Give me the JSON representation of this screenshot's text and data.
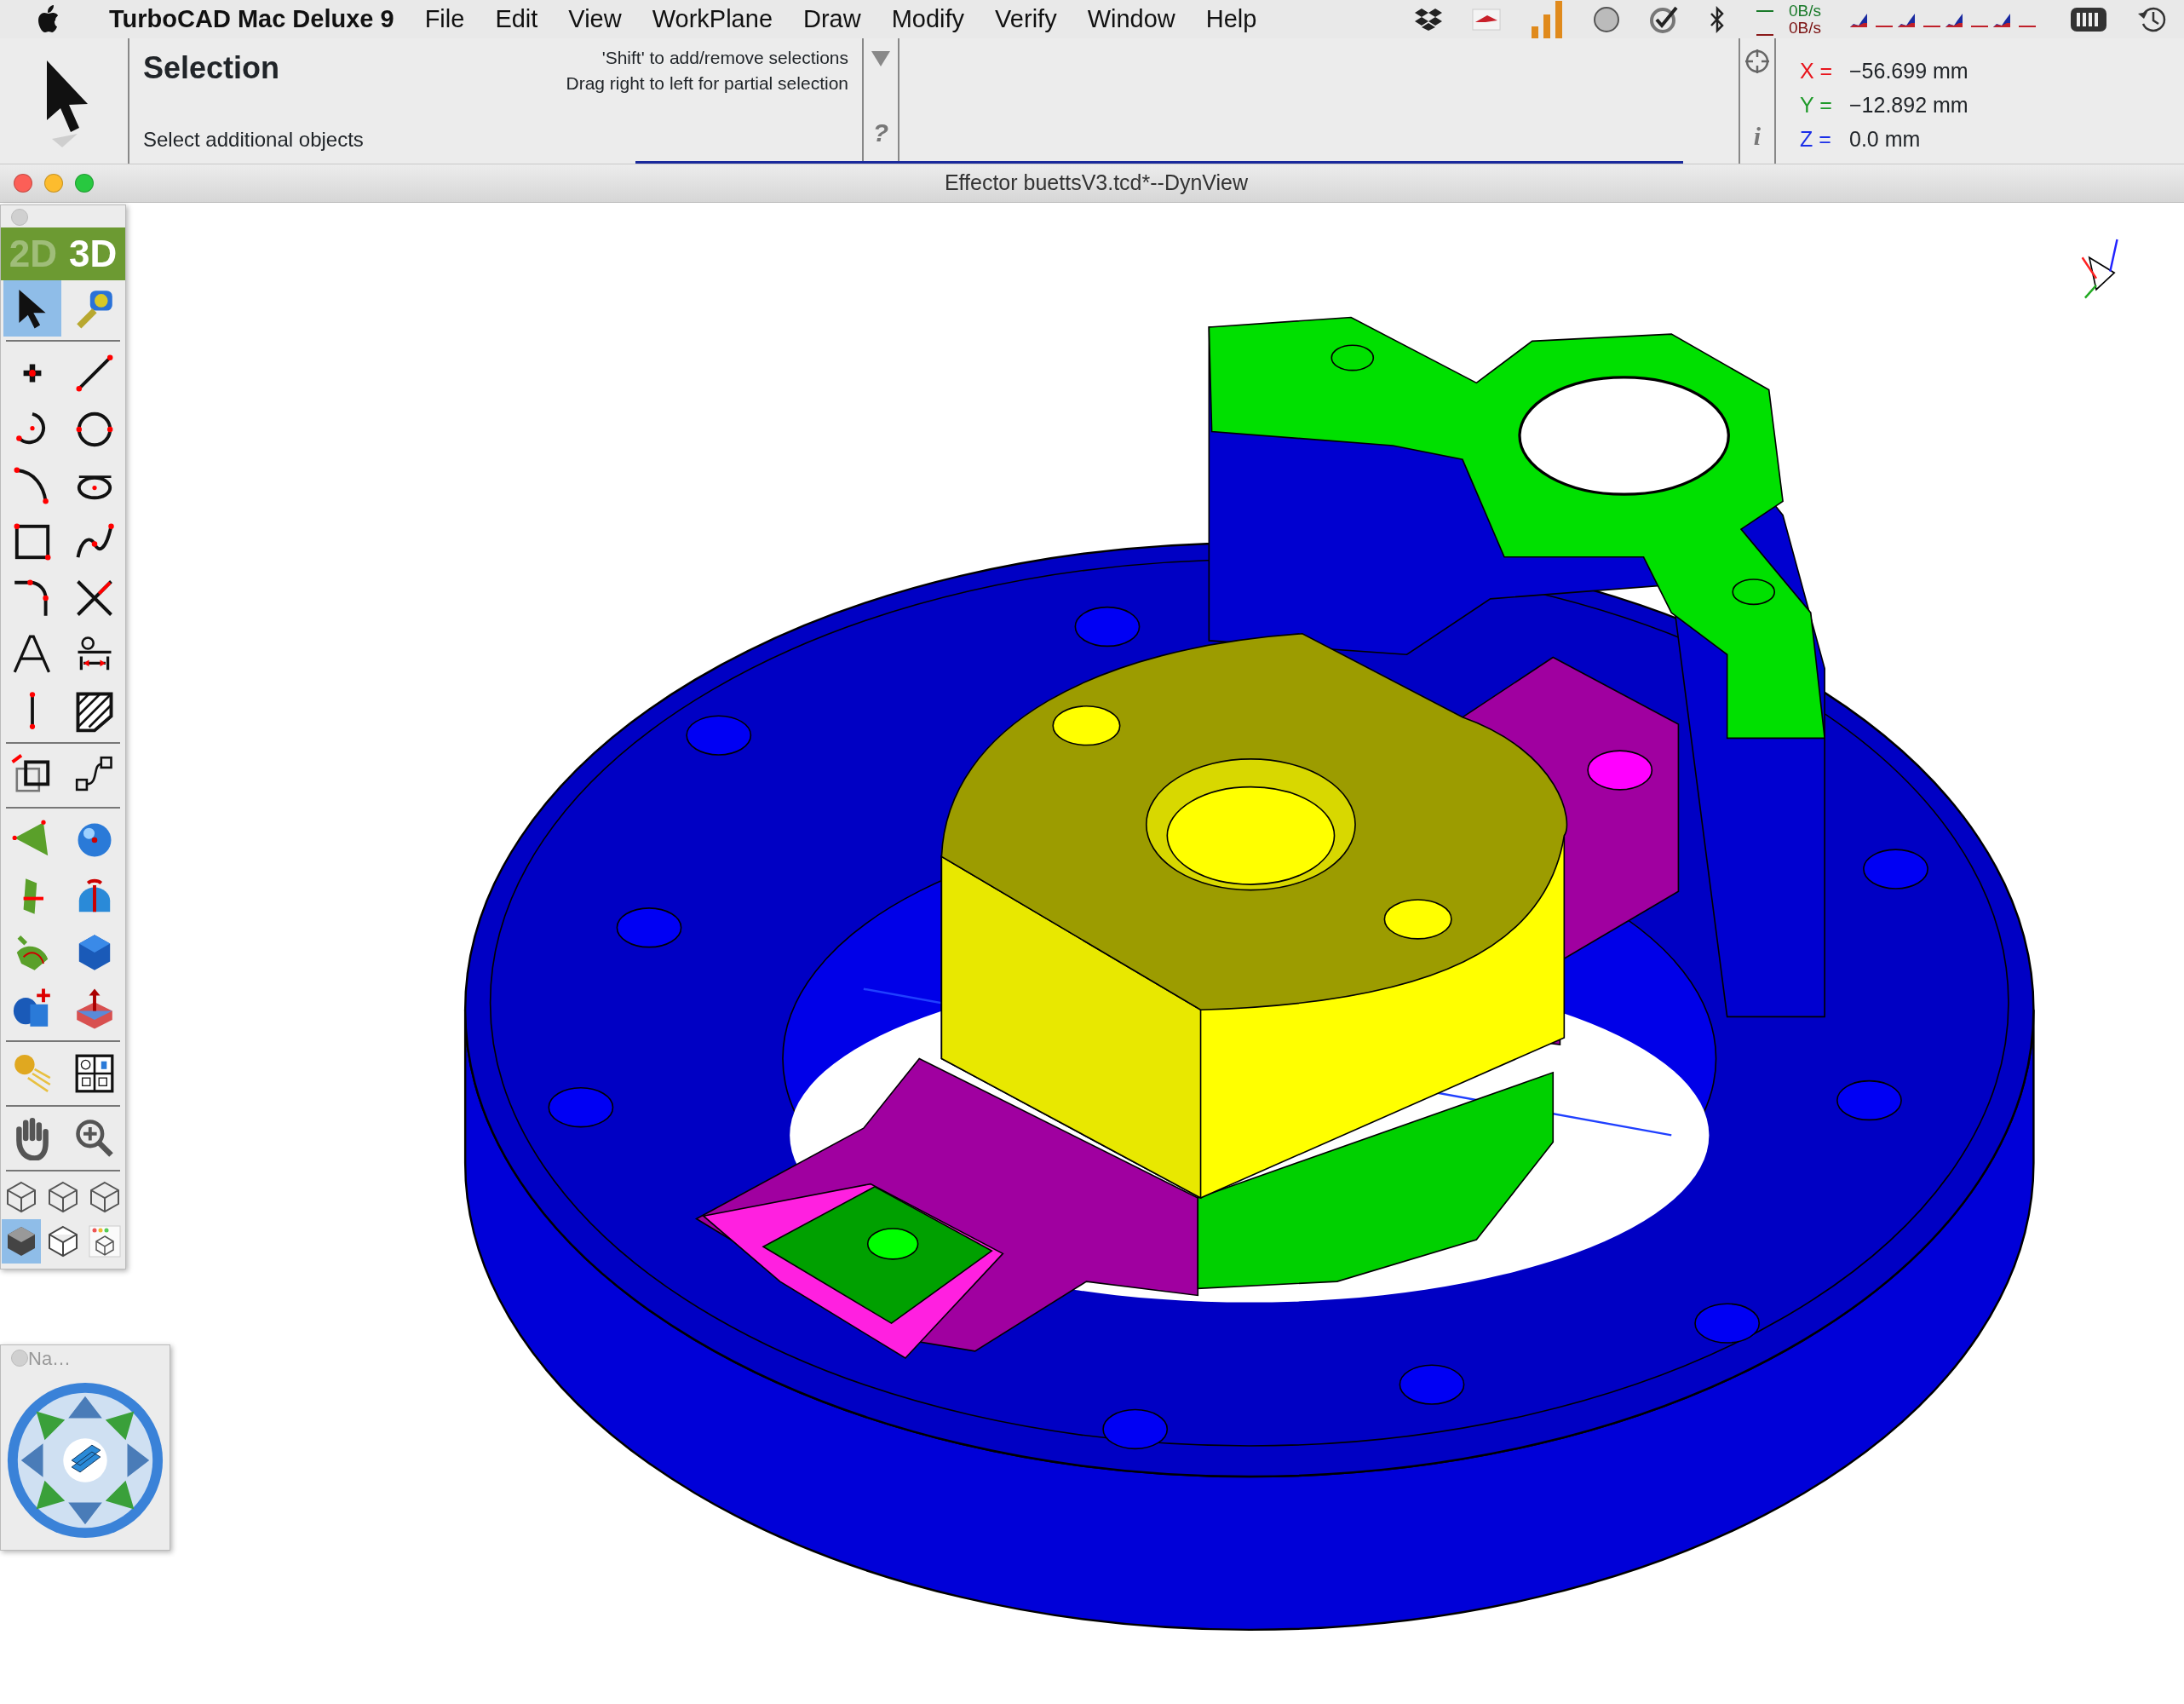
{
  "menu_bar": {
    "app_name": "TurboCAD Mac Deluxe 9",
    "menus": [
      "File",
      "Edit",
      "View",
      "WorkPlane",
      "Draw",
      "Modify",
      "Verify",
      "Window",
      "Help"
    ],
    "network_up": "0B/s",
    "network_down": "0B/s"
  },
  "inspector": {
    "title": "Selection",
    "hints": [
      "'Shift' to add/remove selections",
      "Drag right to left for partial selection"
    ],
    "prompt": "Select additional objects",
    "help_label": "?",
    "info_label": "i",
    "coordinates": [
      {
        "axis": "X =",
        "color": "#e8141c",
        "value": "−56.699 mm"
      },
      {
        "axis": "Y =",
        "color": "#1f9a2a",
        "value": "−12.892 mm"
      },
      {
        "axis": "Z =",
        "color": "#1a2ee8",
        "value": "0.0 mm"
      }
    ]
  },
  "document_window": {
    "title": "Effector buettsV3.tcd*--DynView"
  },
  "tool_palette": {
    "modes": [
      {
        "label": "2D",
        "selected": false
      },
      {
        "label": "3D",
        "selected": true
      }
    ],
    "groups": [
      [
        {
          "kind": "select",
          "selected": true
        },
        {
          "kind": "measure",
          "selected": false
        }
      ],
      [
        {
          "kind": "point",
          "selected": false
        },
        {
          "kind": "line",
          "selected": false
        },
        {
          "kind": "arc",
          "selected": false
        },
        {
          "kind": "circle",
          "selected": false
        },
        {
          "kind": "curve",
          "selected": false
        },
        {
          "kind": "ellipse",
          "selected": false
        },
        {
          "kind": "rect",
          "selected": false
        },
        {
          "kind": "spline",
          "selected": false
        },
        {
          "kind": "fillet",
          "selected": false
        },
        {
          "kind": "intersect",
          "selected": false
        },
        {
          "kind": "text",
          "selected": false
        },
        {
          "kind": "dimension",
          "selected": false
        },
        {
          "kind": "centerline",
          "selected": false
        },
        {
          "kind": "hatch",
          "selected": false
        }
      ],
      [
        {
          "kind": "transform",
          "selected": false
        },
        {
          "kind": "nodes",
          "selected": false
        }
      ],
      [
        {
          "kind": "surface",
          "selected": false
        },
        {
          "kind": "sphere",
          "selected": false
        },
        {
          "kind": "plane",
          "selected": false
        },
        {
          "kind": "revolve",
          "selected": false
        },
        {
          "kind": "loft",
          "selected": false
        },
        {
          "kind": "cube",
          "selected": false
        },
        {
          "kind": "boolean",
          "selected": false
        },
        {
          "kind": "pushpull",
          "selected": false
        }
      ],
      [
        {
          "kind": "render",
          "selected": false
        },
        {
          "kind": "viewports",
          "selected": false
        }
      ],
      [
        {
          "kind": "pan",
          "selected": false
        },
        {
          "kind": "zoom",
          "selected": false
        }
      ]
    ],
    "view_modes": [
      {
        "kind": "wire",
        "selected": false
      },
      {
        "kind": "wire",
        "selected": false
      },
      {
        "kind": "wire",
        "selected": false
      },
      {
        "kind": "shaded",
        "selected": true
      },
      {
        "kind": "hidden",
        "selected": false
      },
      {
        "kind": "window",
        "selected": false
      }
    ]
  },
  "navigator": {
    "title": "Na…"
  }
}
